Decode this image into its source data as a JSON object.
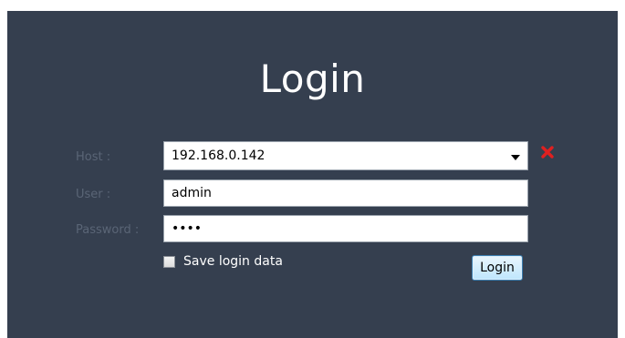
{
  "login": {
    "title": "Login",
    "host_label": "Host :",
    "host_value": "192.168.0.142",
    "user_label": "User :",
    "user_value": "admin",
    "password_label": "Password :",
    "password_value": "abcd",
    "save_label": "Save login data",
    "save_checked": false,
    "login_button": "Login",
    "clear_icon": "close-icon"
  },
  "colors": {
    "panel_background": "#353f4f",
    "label_text": "#5a6576",
    "title_text": "#ffffff",
    "clear_icon": "#e02020",
    "button_border": "#3c7fb1"
  }
}
